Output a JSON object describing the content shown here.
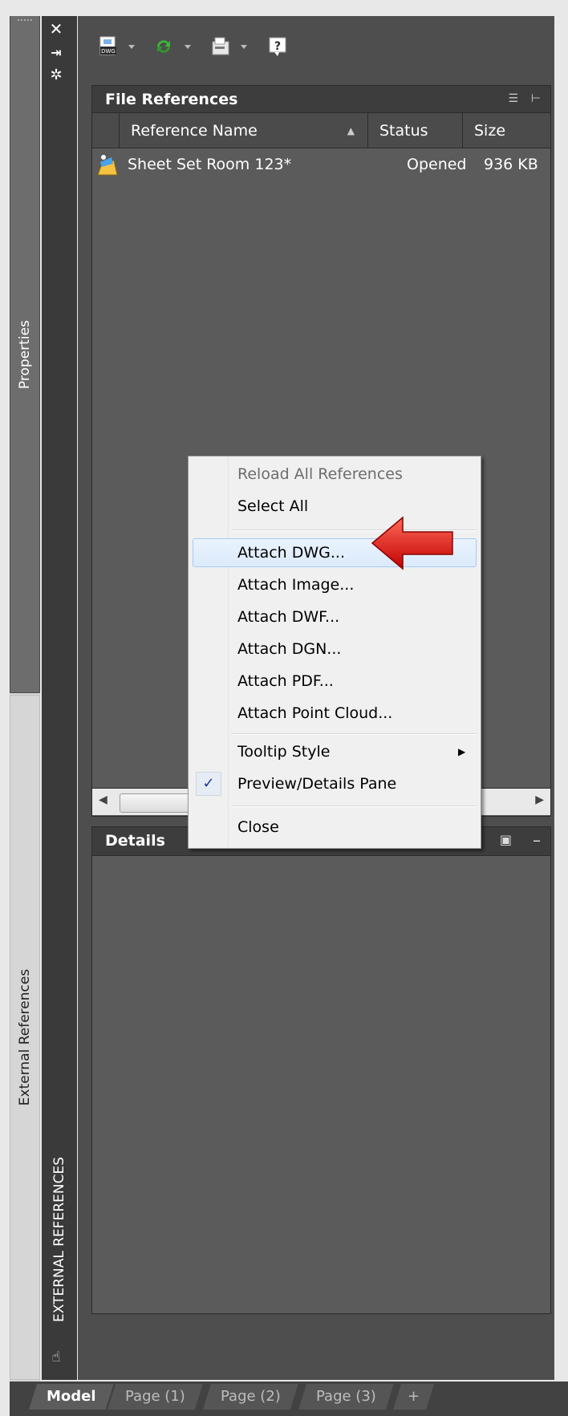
{
  "side_tabs": {
    "properties": "Properties",
    "external_references": "External References"
  },
  "titlebar": {
    "label": "EXTERNAL REFERENCES",
    "close_icon": "close-icon",
    "autohide_icon": "autohide-icon",
    "settings_icon": "settings-icon"
  },
  "toolbar": {
    "attach_icon_text": "DWG",
    "icons": [
      "attach-dwg-icon",
      "refresh-icon",
      "change-path-icon",
      "help-icon"
    ]
  },
  "file_references": {
    "title": "File References",
    "columns": [
      "Reference Name",
      "Status",
      "Size"
    ],
    "rows": [
      {
        "name": "Sheet Set Room 123*",
        "status": "Opened",
        "size": "936 KB"
      }
    ]
  },
  "details": {
    "title": "Details"
  },
  "context_menu": {
    "items": [
      {
        "label": "Reload All References",
        "disabled": true
      },
      {
        "label": "Select All"
      },
      {
        "label": "Attach DWG...",
        "highlighted": true
      },
      {
        "label": "Attach Image..."
      },
      {
        "label": "Attach DWF..."
      },
      {
        "label": "Attach DGN..."
      },
      {
        "label": "Attach PDF..."
      },
      {
        "label": "Attach Point Cloud..."
      },
      {
        "label": "Tooltip Style",
        "submenu": true
      },
      {
        "label": "Preview/Details Pane",
        "checked": true
      },
      {
        "label": "Close"
      }
    ]
  },
  "layout_tabs": [
    "Model",
    "Page (1)",
    "Page (2)",
    "Page (3)",
    "+"
  ],
  "colors": {
    "panel_bg": "#4e4e4e",
    "list_bg": "#5b5b5b",
    "menu_bg": "#f0f0f0",
    "highlight": "#dbeafc",
    "arrow": "#e31b1b"
  }
}
